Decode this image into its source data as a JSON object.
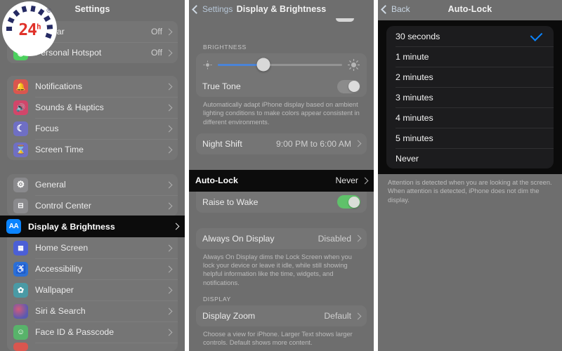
{
  "watermark": {
    "text": "24",
    "superscript": "h",
    "registered": "®",
    "accent": "#e0322a",
    "dash_color": "#252a63"
  },
  "panels": {
    "left": {
      "nav": {
        "title": "Settings"
      },
      "top_group": [
        {
          "label": "Cellular",
          "value": "Off",
          "icon": "cellular-icon",
          "icon_color": "#4cd05e"
        },
        {
          "label": "Personal Hotspot",
          "value": "Off",
          "icon": "hotspot-icon",
          "icon_color": "#4cd05e"
        }
      ],
      "group_two": [
        {
          "label": "Notifications",
          "icon": "bell-icon",
          "icon_color": "#d9564f",
          "glyph": "🔔"
        },
        {
          "label": "Sounds & Haptics",
          "icon": "speaker-icon",
          "icon_color": "#d1466a",
          "glyph": "🔊"
        },
        {
          "label": "Focus",
          "icon": "moon-icon",
          "icon_color": "#6f6fc4",
          "glyph": "☾"
        },
        {
          "label": "Screen Time",
          "icon": "hourglass-icon",
          "icon_color": "#6f6fc4",
          "glyph": "⌛"
        }
      ],
      "group_three": [
        {
          "label": "General",
          "icon": "gear-icon",
          "icon_color": "#8a8a8d",
          "glyph": "⚙"
        },
        {
          "label": "Control Center",
          "icon": "sliders-icon",
          "icon_color": "#8a8a8d",
          "glyph": "☰"
        },
        {
          "label": "Display & Brightness",
          "icon": "display-brightness-icon",
          "icon_color": "#0a84ff",
          "glyph": "AA",
          "selected": true
        },
        {
          "label": "Home Screen",
          "icon": "home-screen-grid-icon",
          "icon_color": "#4b5fd6",
          "glyph": "▒"
        },
        {
          "label": "Accessibility",
          "icon": "accessibility-icon",
          "icon_color": "#2b6fd6",
          "glyph": "⛹"
        },
        {
          "label": "Wallpaper",
          "icon": "wallpaper-icon",
          "icon_color": "#4a9aa5",
          "glyph": "✿"
        },
        {
          "label": "Siri & Search",
          "icon": "siri-icon",
          "icon_color": "#7a5a8a",
          "glyph": "●"
        },
        {
          "label": "Face ID & Passcode",
          "icon": "face-id-icon",
          "icon_color": "#58b36a",
          "glyph": "☸"
        }
      ]
    },
    "middle": {
      "nav": {
        "back_label": "Settings",
        "title": "Display & Brightness"
      },
      "brightness_header": "BRIGHTNESS",
      "slider": {
        "value_percent": 37,
        "low_icon": "sun-small-icon",
        "high_icon": "sun-large-icon"
      },
      "true_tone": {
        "label": "True Tone",
        "state": "off"
      },
      "true_tone_footnote": "Automatically adapt iPhone display based on ambient lighting conditions to make colors appear consistent in different environments.",
      "night_shift": {
        "label": "Night Shift",
        "value": "9:00 PM to 6:00 AM"
      },
      "auto_lock": {
        "label": "Auto-Lock",
        "value": "Never",
        "selected": true
      },
      "raise_to_wake": {
        "label": "Raise to Wake",
        "state": "on"
      },
      "always_on_display": {
        "label": "Always On Display",
        "value": "Disabled"
      },
      "always_on_footnote": "Always On Display dims the Lock Screen when you lock your device or leave it idle, while still showing helpful information like the time, widgets, and notifications.",
      "display_header": "DISPLAY",
      "display_zoom": {
        "label": "Display Zoom",
        "value": "Default"
      },
      "display_zoom_footnote": "Choose a view for iPhone. Larger Text shows larger controls. Default shows more content."
    },
    "right": {
      "nav": {
        "back_label": "Back",
        "title": "Auto-Lock"
      },
      "options": [
        {
          "label": "30 seconds",
          "checked": true
        },
        {
          "label": "1 minute",
          "checked": false
        },
        {
          "label": "2 minutes",
          "checked": false
        },
        {
          "label": "3 minutes",
          "checked": false
        },
        {
          "label": "4 minutes",
          "checked": false
        },
        {
          "label": "5 minutes",
          "checked": false
        },
        {
          "label": "Never",
          "checked": false
        }
      ],
      "footnote": "Attention is detected when you are looking at the screen. When attention is detected, iPhone does not dim the display.",
      "check_color": "#0a84ff"
    }
  }
}
